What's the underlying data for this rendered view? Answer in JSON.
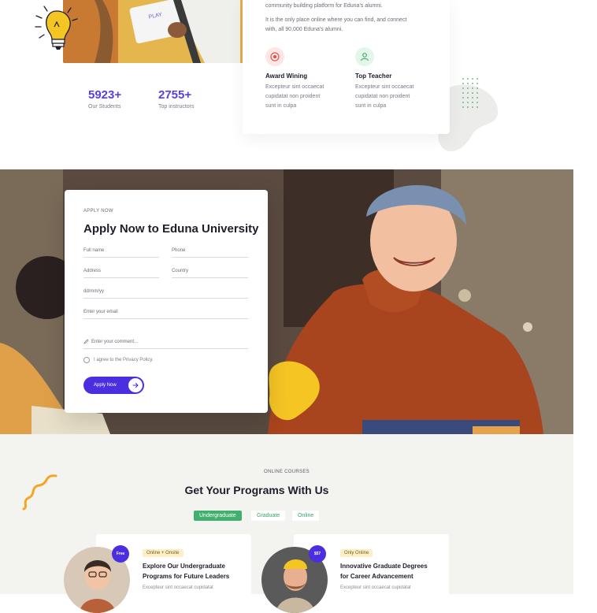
{
  "about": {
    "line_1": "community building platform for Eduna's alumni.",
    "line_2": "It is the only place online where you can find, and connect",
    "line_3": "with, all 90,000 Eduna's alumni.",
    "features": [
      {
        "title": "Award Wining",
        "icon": "award-icon",
        "icon_bg": "#fde7e5",
        "icon_color": "#e2574c",
        "text": [
          "Excepteur sint occaecat",
          "cupidatat non proident",
          "sunt in culpa"
        ]
      },
      {
        "title": "Top Teacher",
        "icon": "teacher-icon",
        "icon_bg": "#e4f6ea",
        "icon_color": "#41b06e",
        "text": [
          "Excepteur sint occaecat",
          "cupidatat non proident",
          "sunt in culpa"
        ]
      }
    ],
    "book_label": "PLAY"
  },
  "stats": [
    {
      "value": "5923+",
      "label": "Our Students"
    },
    {
      "value": "2755+",
      "label": "Top instructors"
    }
  ],
  "apply": {
    "eyebrow": "APPLY NOW",
    "title": "Apply Now to Eduna University",
    "fields": {
      "full_name": "Full name",
      "phone": "Phone",
      "address": "Address",
      "country": "Country",
      "dob": "dd/mm/yy",
      "email": "Enter your email",
      "comment": "Enter your comment..."
    },
    "agree": "I agree to the Privacy Policy.",
    "button": "Apply Now"
  },
  "programs": {
    "eyebrow": "ONLINE COURSES",
    "title": "Get Your Programs With Us",
    "tabs": [
      "Undergraduate",
      "Graduate",
      "Online"
    ],
    "active_tab": "Undergraduate",
    "courses": [
      {
        "badge": "Free",
        "chip": "Online + Onsite",
        "title_1": "Explore Our Undergraduate",
        "title_2": "Programs for Future Leaders",
        "desc": "Excepteur sint occaecat cupidatat"
      },
      {
        "badge": "$57",
        "chip": "Only Online",
        "title_1": "Innovative Graduate Degrees",
        "title_2": "for Career Advancement",
        "desc": "Excepteur sint occaecat cupidatat"
      }
    ]
  },
  "colors": {
    "accent": "#4a2ee0",
    "green": "#41b06e",
    "yellow": "#f5c524"
  }
}
